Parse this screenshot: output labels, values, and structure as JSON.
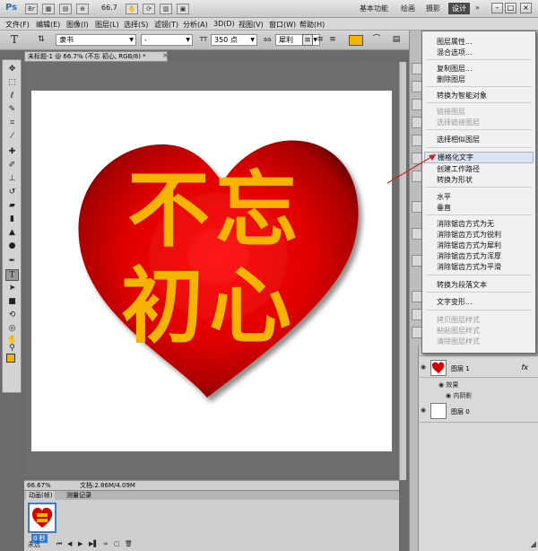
{
  "app": {
    "logo": "Ps",
    "zoom": "66.7"
  },
  "workspaces": [
    "基本功能",
    "绘画",
    "摄影",
    "设计",
    "»"
  ],
  "window_buttons": [
    "–",
    "□",
    "×"
  ],
  "menu": [
    "文件(F)",
    "编辑(E)",
    "图像(I)",
    "图层(L)",
    "选择(S)",
    "滤镜(T)",
    "分析(A)",
    "3D(D)",
    "视图(V)",
    "窗口(W)",
    "帮助(H)"
  ],
  "options": {
    "font_family": "隶书",
    "font_style": "-",
    "font_size": "350 点",
    "aa_mode": "犀利",
    "tool_icon": "T",
    "orient_icon": "⇅",
    "size_icon": "TT",
    "aa_label": "aa"
  },
  "document": {
    "tab_title": "未标题-1 @ 66.7% (不忘  初心, RGB/8) *",
    "close": "×",
    "text_line1": "不忘",
    "text_line2": "初心"
  },
  "status": {
    "zoom": "66.67%",
    "doc_info": "文档:2.86M/4.09M"
  },
  "animation": {
    "tabs": [
      "动画(帧)",
      "测量记录"
    ],
    "frame_time": "0 秒",
    "loop": "永远"
  },
  "layers": {
    "layer1": "图层 1",
    "effects": "效果",
    "inner_shadow": "内阴影",
    "layer0": "图层 0",
    "fx": "fx"
  },
  "context_menu": {
    "items": [
      {
        "label": "图层属性...",
        "disabled": false
      },
      {
        "label": "混合选项...",
        "disabled": false
      },
      {
        "label": "复制图层...",
        "disabled": false
      },
      {
        "label": "删除图层",
        "disabled": false
      },
      {
        "label": "转换为智能对象",
        "disabled": false
      },
      {
        "label": "链接图层",
        "disabled": true
      },
      {
        "label": "选择链接图层",
        "disabled": true
      },
      {
        "label": "选择相似图层",
        "disabled": false
      },
      {
        "label": "栅格化文字",
        "disabled": false,
        "highlighted": true
      },
      {
        "label": "创建工作路径",
        "disabled": false
      },
      {
        "label": "转换为形状",
        "disabled": false
      },
      {
        "label": "水平",
        "disabled": false
      },
      {
        "label": "垂直",
        "disabled": false
      },
      {
        "label": "消除锯齿方式为无",
        "disabled": false
      },
      {
        "label": "消除锯齿方式为锐利",
        "disabled": false
      },
      {
        "label": "消除锯齿方式为犀利",
        "disabled": false
      },
      {
        "label": "消除锯齿方式为浑厚",
        "disabled": false
      },
      {
        "label": "消除锯齿方式为平滑",
        "disabled": false
      },
      {
        "label": "转换为段落文本",
        "disabled": false
      },
      {
        "label": "文字变形...",
        "disabled": false
      },
      {
        "label": "拷贝图层样式",
        "disabled": true
      },
      {
        "label": "粘贴图层样式",
        "disabled": true
      },
      {
        "label": "清除图层样式",
        "disabled": true
      }
    ]
  },
  "colors": {
    "heart_red": "#e00000",
    "text_gold": "#f5b400",
    "highlight": "#dbe6f5"
  },
  "icons": [
    "move-icon",
    "marquee-icon",
    "lasso-icon",
    "quick-select-icon",
    "crop-icon",
    "eyedropper-icon",
    "healing-brush-icon",
    "brush-icon",
    "clone-stamp-icon",
    "history-brush-icon",
    "eraser-icon",
    "gradient-icon",
    "blur-icon",
    "dodge-icon",
    "pen-icon",
    "type-icon",
    "path-select-icon",
    "shape-icon",
    "3d-rotate-icon",
    "3d-orbit-icon",
    "hand-icon",
    "zoom-icon"
  ]
}
